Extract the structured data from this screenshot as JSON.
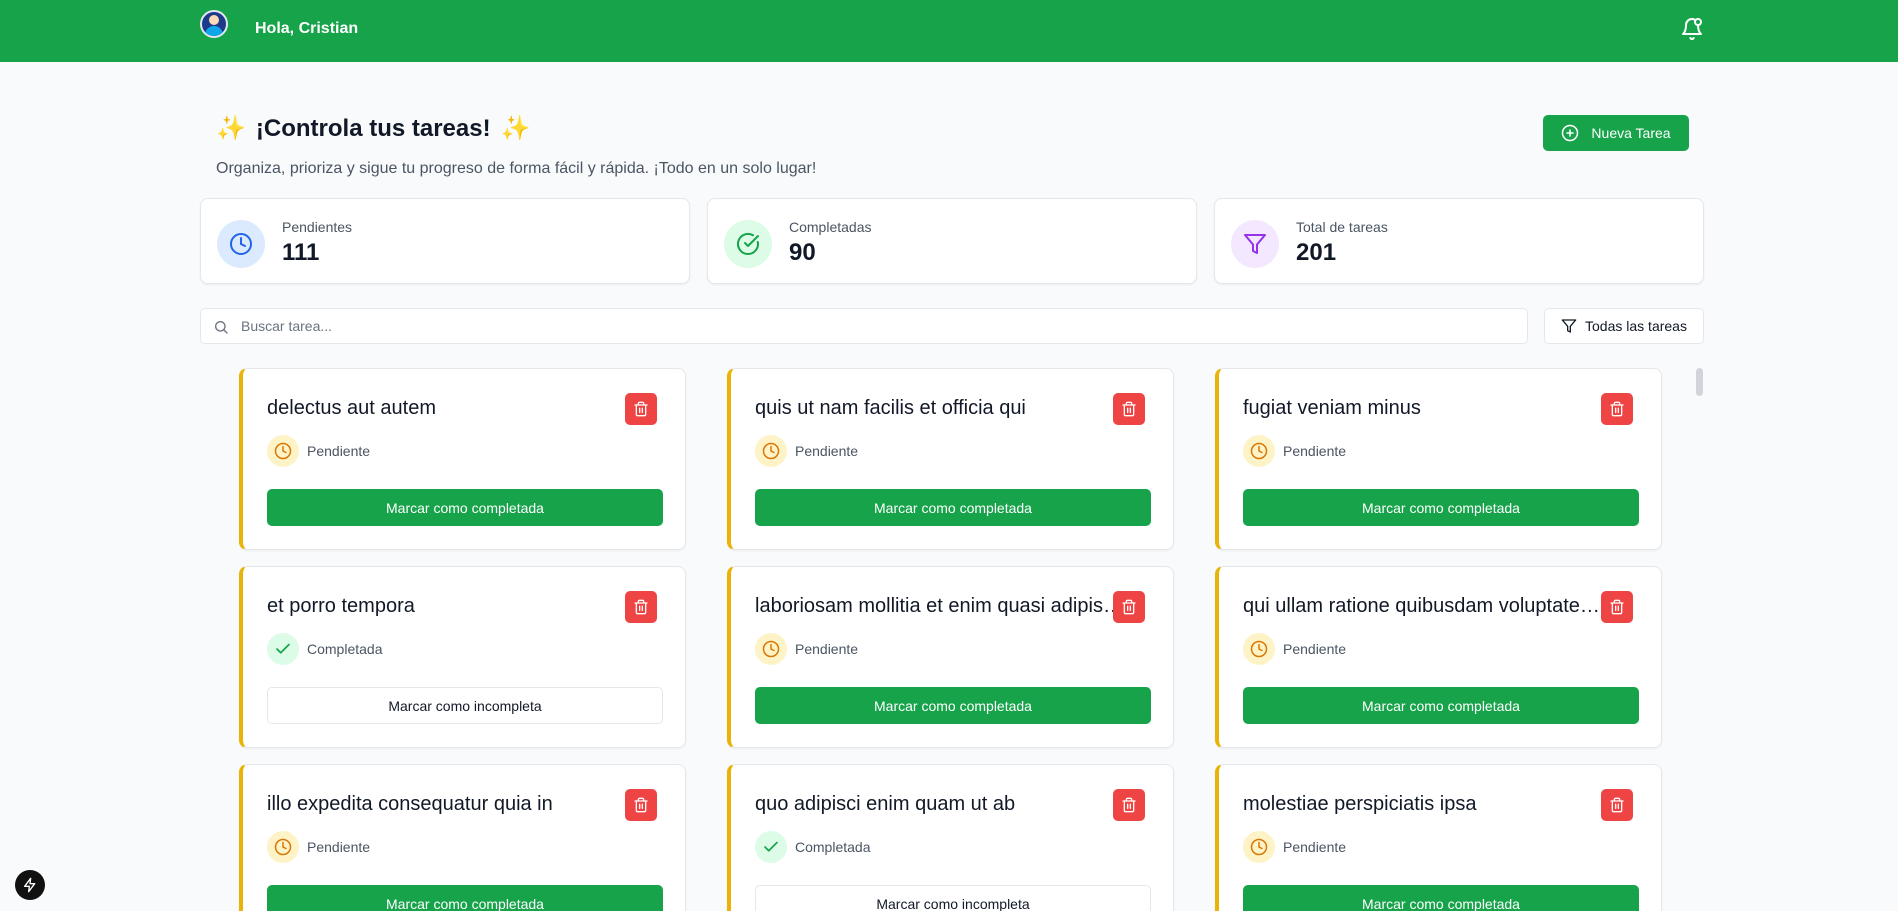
{
  "header": {
    "greeting": "Hola, Cristian"
  },
  "hero": {
    "title": "¡Controla tus tareas!",
    "sparkle_left": "✨",
    "sparkle_right": "✨",
    "subtitle": "Organiza, prioriza y sigue tu progreso de forma fácil y rápida. ¡Todo en un solo lugar!",
    "new_task_label": "Nueva Tarea"
  },
  "stats": [
    {
      "label": "Pendientes",
      "value": "111",
      "icon": "clock-icon",
      "color": "#2563eb",
      "bg": "#dbeafe"
    },
    {
      "label": "Completadas",
      "value": "90",
      "icon": "check-circle-icon",
      "color": "#16a34a",
      "bg": "#dcfce7"
    },
    {
      "label": "Total de tareas",
      "value": "201",
      "icon": "filter-icon",
      "color": "#9333ea",
      "bg": "#f3e8ff"
    }
  ],
  "search": {
    "placeholder": "Buscar tarea..."
  },
  "filter": {
    "label": "Todas las tareas"
  },
  "tasks": [
    {
      "title": "delectus aut autem",
      "status": "Pendiente",
      "action": "Marcar como completada"
    },
    {
      "title": "quis ut nam facilis et officia qui",
      "status": "Pendiente",
      "action": "Marcar como completada"
    },
    {
      "title": "fugiat veniam minus",
      "status": "Pendiente",
      "action": "Marcar como completada"
    },
    {
      "title": "et porro tempora",
      "status": "Completada",
      "action": "Marcar como incompleta"
    },
    {
      "title": "laboriosam mollitia et enim quasi adipisci quia provident illum",
      "status": "Pendiente",
      "action": "Marcar como completada"
    },
    {
      "title": "qui ullam ratione quibusdam voluptatem quia omnis",
      "status": "Pendiente",
      "action": "Marcar como completada"
    },
    {
      "title": "illo expedita consequatur quia in",
      "status": "Pendiente",
      "action": "Marcar como completada"
    },
    {
      "title": "quo adipisci enim quam ut ab",
      "status": "Completada",
      "action": "Marcar como incompleta"
    },
    {
      "title": "molestiae perspiciatis ipsa",
      "status": "Pendiente",
      "action": "Marcar como completada"
    }
  ],
  "colors": {
    "brand": "#16a34a",
    "danger": "#ef4444",
    "pending_accent": "#eab308",
    "pending_icon": "#d97706",
    "done_icon": "#16a34a"
  }
}
